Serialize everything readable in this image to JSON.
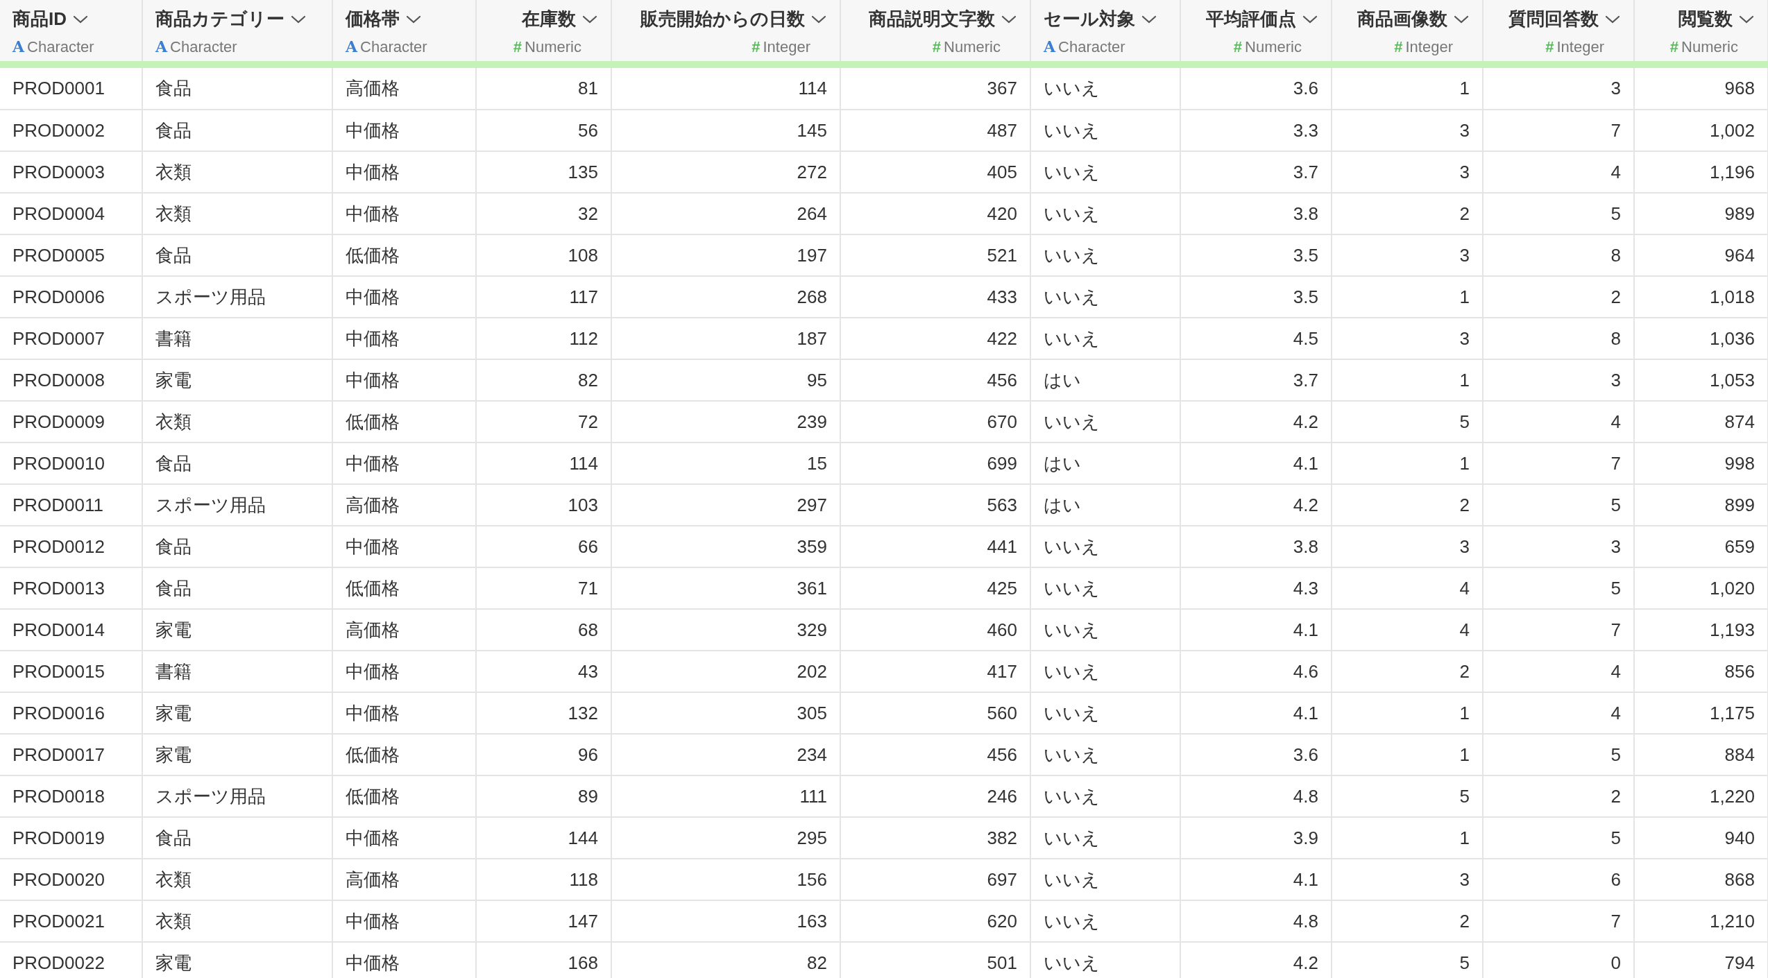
{
  "table": {
    "columns": [
      {
        "name": "商品ID",
        "type_icon": "A",
        "type_label": "Character",
        "kind": "character"
      },
      {
        "name": "商品カテゴリー",
        "type_icon": "A",
        "type_label": "Character",
        "kind": "character"
      },
      {
        "name": "価格帯",
        "type_icon": "A",
        "type_label": "Character",
        "kind": "character"
      },
      {
        "name": "在庫数",
        "type_icon": "#",
        "type_label": "Numeric",
        "kind": "number"
      },
      {
        "name": "販売開始からの日数",
        "type_icon": "#",
        "type_label": "Integer",
        "kind": "number"
      },
      {
        "name": "商品説明文字数",
        "type_icon": "#",
        "type_label": "Numeric",
        "kind": "number"
      },
      {
        "name": "セール対象",
        "type_icon": "A",
        "type_label": "Character",
        "kind": "character"
      },
      {
        "name": "平均評価点",
        "type_icon": "#",
        "type_label": "Numeric",
        "kind": "number"
      },
      {
        "name": "商品画像数",
        "type_icon": "#",
        "type_label": "Integer",
        "kind": "number"
      },
      {
        "name": "質問回答数",
        "type_icon": "#",
        "type_label": "Integer",
        "kind": "number"
      },
      {
        "name": "閲覧数",
        "type_icon": "#",
        "type_label": "Numeric",
        "kind": "number"
      }
    ],
    "rows": [
      [
        "PROD0001",
        "食品",
        "高価格",
        "81",
        "114",
        "367",
        "いいえ",
        "3.6",
        "1",
        "3",
        "968"
      ],
      [
        "PROD0002",
        "食品",
        "中価格",
        "56",
        "145",
        "487",
        "いいえ",
        "3.3",
        "3",
        "7",
        "1,002"
      ],
      [
        "PROD0003",
        "衣類",
        "中価格",
        "135",
        "272",
        "405",
        "いいえ",
        "3.7",
        "3",
        "4",
        "1,196"
      ],
      [
        "PROD0004",
        "衣類",
        "中価格",
        "32",
        "264",
        "420",
        "いいえ",
        "3.8",
        "2",
        "5",
        "989"
      ],
      [
        "PROD0005",
        "食品",
        "低価格",
        "108",
        "197",
        "521",
        "いいえ",
        "3.5",
        "3",
        "8",
        "964"
      ],
      [
        "PROD0006",
        "スポーツ用品",
        "中価格",
        "117",
        "268",
        "433",
        "いいえ",
        "3.5",
        "1",
        "2",
        "1,018"
      ],
      [
        "PROD0007",
        "書籍",
        "中価格",
        "112",
        "187",
        "422",
        "いいえ",
        "4.5",
        "3",
        "8",
        "1,036"
      ],
      [
        "PROD0008",
        "家電",
        "中価格",
        "82",
        "95",
        "456",
        "はい",
        "3.7",
        "1",
        "3",
        "1,053"
      ],
      [
        "PROD0009",
        "衣類",
        "低価格",
        "72",
        "239",
        "670",
        "いいえ",
        "4.2",
        "5",
        "4",
        "874"
      ],
      [
        "PROD0010",
        "食品",
        "中価格",
        "114",
        "15",
        "699",
        "はい",
        "4.1",
        "1",
        "7",
        "998"
      ],
      [
        "PROD0011",
        "スポーツ用品",
        "高価格",
        "103",
        "297",
        "563",
        "はい",
        "4.2",
        "2",
        "5",
        "899"
      ],
      [
        "PROD0012",
        "食品",
        "中価格",
        "66",
        "359",
        "441",
        "いいえ",
        "3.8",
        "3",
        "3",
        "659"
      ],
      [
        "PROD0013",
        "食品",
        "低価格",
        "71",
        "361",
        "425",
        "いいえ",
        "4.3",
        "4",
        "5",
        "1,020"
      ],
      [
        "PROD0014",
        "家電",
        "高価格",
        "68",
        "329",
        "460",
        "いいえ",
        "4.1",
        "4",
        "7",
        "1,193"
      ],
      [
        "PROD0015",
        "書籍",
        "中価格",
        "43",
        "202",
        "417",
        "いいえ",
        "4.6",
        "2",
        "4",
        "856"
      ],
      [
        "PROD0016",
        "家電",
        "中価格",
        "132",
        "305",
        "560",
        "いいえ",
        "4.1",
        "1",
        "4",
        "1,175"
      ],
      [
        "PROD0017",
        "家電",
        "低価格",
        "96",
        "234",
        "456",
        "いいえ",
        "3.6",
        "1",
        "5",
        "884"
      ],
      [
        "PROD0018",
        "スポーツ用品",
        "低価格",
        "89",
        "111",
        "246",
        "いいえ",
        "4.8",
        "5",
        "2",
        "1,220"
      ],
      [
        "PROD0019",
        "食品",
        "中価格",
        "144",
        "295",
        "382",
        "いいえ",
        "3.9",
        "1",
        "5",
        "940"
      ],
      [
        "PROD0020",
        "衣類",
        "高価格",
        "118",
        "156",
        "697",
        "いいえ",
        "4.1",
        "3",
        "6",
        "868"
      ],
      [
        "PROD0021",
        "衣類",
        "中価格",
        "147",
        "163",
        "620",
        "いいえ",
        "4.8",
        "2",
        "7",
        "1,210"
      ],
      [
        "PROD0022",
        "家電",
        "中価格",
        "168",
        "82",
        "501",
        "いいえ",
        "4.2",
        "5",
        "0",
        "794"
      ]
    ]
  }
}
